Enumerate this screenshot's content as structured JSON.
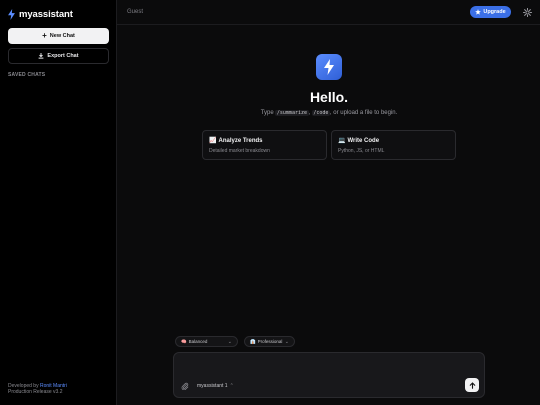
{
  "sidebar": {
    "brand": "myassistant",
    "new_chat_label": "New Chat",
    "export_chat_label": "Export Chat",
    "saved_chats_title": "SAVED CHATS",
    "footer_prefix": "Developed by ",
    "footer_author": "Ronit Mantri",
    "footer_release": "Production Release v3.2"
  },
  "header": {
    "user": "Guest",
    "upgrade_label": "Upgrade"
  },
  "hero": {
    "title": "Hello.",
    "sub_prefix": "Type ",
    "cmd1": "/summarize",
    "sub_mid": ", ",
    "cmd2": "/code",
    "sub_suffix": ", or upload a file to begin."
  },
  "cards": [
    {
      "emoji": "📈",
      "title": "Analyze Trends",
      "desc": "Detailed market breakdown"
    },
    {
      "emoji": "💻",
      "title": "Write Code",
      "desc": "Python, JS, or HTML"
    }
  ],
  "composer": {
    "mode_emoji": "🧠",
    "mode": "Balanced",
    "tone_emoji": "👔",
    "tone": "Professional",
    "model": "myassistant 1"
  },
  "colors": {
    "accent": "#3b6fe6",
    "link": "#5b8dff",
    "background": "#0b0b0c"
  },
  "icons": [
    "bolt-icon",
    "plus-icon",
    "download-icon",
    "star-icon",
    "gear-icon",
    "paperclip-icon",
    "arrow-up-icon",
    "chevron-down-icon"
  ]
}
